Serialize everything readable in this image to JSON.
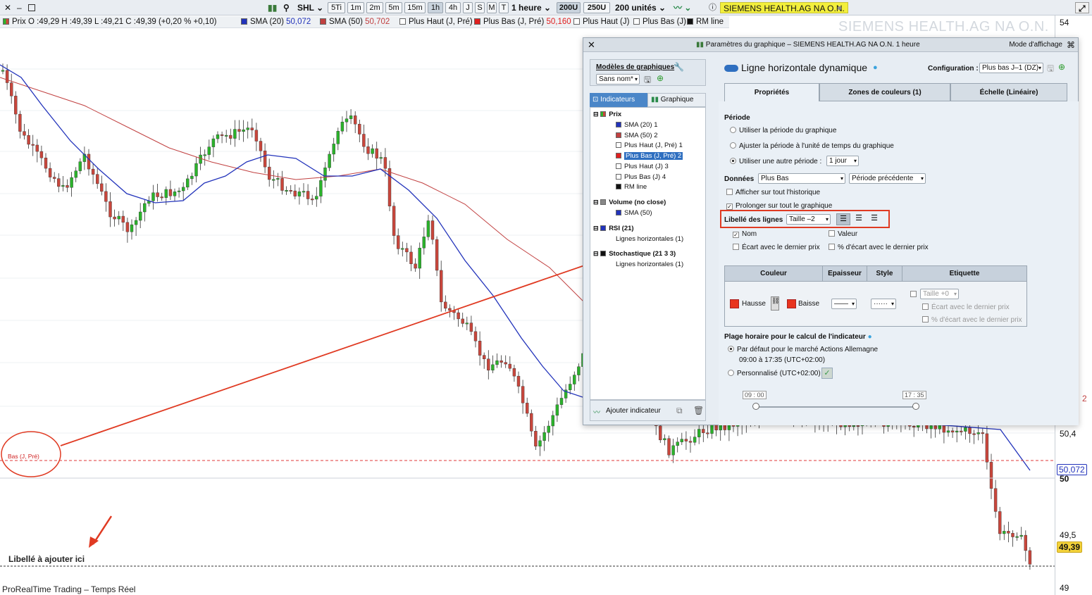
{
  "toolbar": {
    "ticker": "SHL",
    "timeframes": [
      "5Ti",
      "1m",
      "2m",
      "5m",
      "15m",
      "1h",
      "4h",
      "J",
      "S",
      "M",
      "T"
    ],
    "selected_timeframe": "1h",
    "period": "1 heure",
    "bars": [
      "200U",
      "250U"
    ],
    "units": "200 unités",
    "instrument": "SIEMENS HEALTH.AG NA O.N."
  },
  "legend": {
    "price": "Prix O :49,29 H :49,39 L :49,21 C :49,39 (+0,20 % +0,10)",
    "sma20": "SMA (20)",
    "sma20_val": "50,072",
    "sma50": "SMA (50)",
    "sma50_val": "50,702",
    "plus_haut_pre": "Plus Haut (J, Pré)",
    "plus_bas_pre": "Plus Bas (J, Pré)",
    "plus_bas_pre_val": "50,160",
    "plus_haut": "Plus Haut (J)",
    "plus_bas": "Plus Bas (J)",
    "rm_line": "RM line"
  },
  "watermark": "SIEMENS HEALTH.AG NA O.N.",
  "axis": {
    "labels": [
      "54",
      "50,4",
      "50",
      "49,5",
      "49"
    ],
    "sma20_tag": "50,072",
    "last_price_tag": "49,39",
    "side_tag": "2"
  },
  "chart": {
    "line_label": "Bas (J, Pré)",
    "annotation": "Libellé à ajouter ici",
    "footer": "ProRealTime Trading – Temps Réel"
  },
  "dialog": {
    "title": "Paramètres du graphique – SIEMENS HEALTH.AG NA O.N. 1 heure",
    "mode": "Mode d'affichage",
    "models_label": "Modèles de graphiques",
    "models_value": "Sans nom*",
    "left_tabs": [
      "Indicateurs",
      "Graphique"
    ],
    "tree": {
      "prix": "Prix",
      "prix_items": [
        "SMA (20) 1",
        "SMA (50) 2",
        "Plus Haut (J, Pré) 1",
        "Plus Bas (J, Pré) 2",
        "Plus Haut (J) 3",
        "Plus Bas (J) 4",
        "RM line"
      ],
      "volume": "Volume (no close)",
      "volume_items": [
        "SMA (50)"
      ],
      "rsi": "RSI (21)",
      "rsi_items": [
        "Lignes horizontales (1)"
      ],
      "stoch": "Stochastique (21 3 3)",
      "stoch_items": [
        "Lignes horizontales (1)"
      ]
    },
    "add_indicator": "Ajouter indicateur",
    "heading": "Ligne horizontale dynamique",
    "config_label": "Configuration :",
    "config_value": "Plus bas J–1 (DZ)",
    "tabs": [
      "Propriétés",
      "Zones de couleurs (1)",
      "Échelle (Linéaire)"
    ],
    "periode": "Période",
    "periode_options": [
      "Utiliser la période du graphique",
      "Ajuster la période à l'unité de temps du graphique",
      "Utiliser une autre période :"
    ],
    "periode_value": "1 jour",
    "donnees": "Données",
    "donnees_value": "Plus Bas",
    "donnees_period": "Période précédente",
    "afficher": "Afficher sur tout l'historique",
    "prolonger": "Prolonger sur tout le graphique",
    "libelle_label": "Libellé des lignes",
    "libelle_size": "Taille –2",
    "nom": "Nom",
    "valeur": "Valeur",
    "ecart": "Écart avec le dernier prix",
    "pct_ecart": "% d'écart avec le dernier prix",
    "table_headers": [
      "Couleur",
      "Epaisseur",
      "Style",
      "Etiquette"
    ],
    "hausse": "Hausse",
    "baisse": "Baisse",
    "etiquette_size": "Taille +0",
    "etiquette_ecart": "Écart avec le dernier prix",
    "etiquette_pct": "% d'écart avec le dernier prix",
    "plage": "Plage horaire pour le calcul de l'indicateur",
    "par_defaut": "Par défaut pour le marché Actions Allemagne",
    "hours": "09:00 à 17:35 (UTC+02:00)",
    "personnalise": "Personnalisé (UTC+02:00)",
    "slider_start": "09 : 00",
    "slider_end": "17 : 35"
  },
  "colors": {
    "up": "#2bb32b",
    "down": "#c9463c",
    "sma20": "#2233bb",
    "sma50": "#c14040",
    "highlight": "#e03a22"
  }
}
